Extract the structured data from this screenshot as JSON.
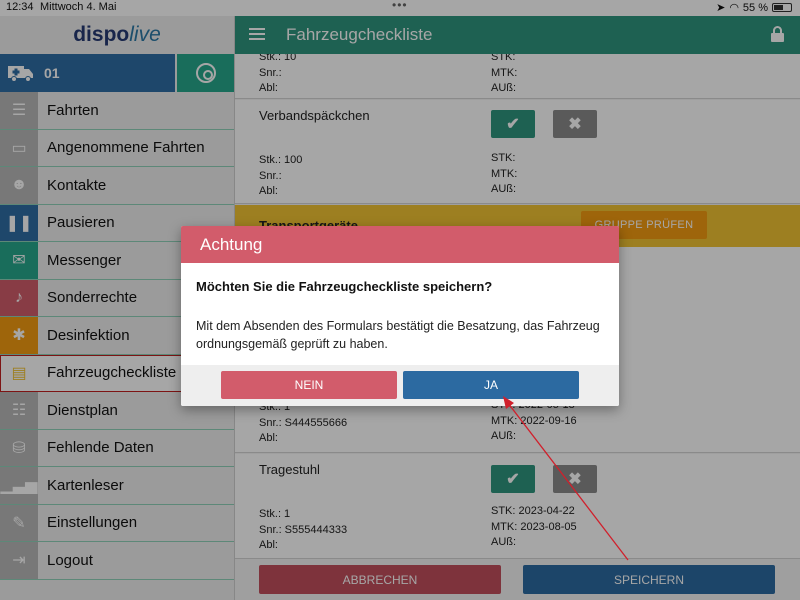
{
  "status_bar": {
    "time": "12:34",
    "date": "Mittwoch 4. Mai",
    "battery": "55 %"
  },
  "sidebar": {
    "logo_part1": "dispo",
    "logo_part2": "live",
    "vehicle_number": "01",
    "items": [
      {
        "label": "Fahrten",
        "icon": "list-icon",
        "color": "#b8b8b8"
      },
      {
        "label": "Angenommene Fahrten",
        "icon": "id-card-icon",
        "color": "#b8b8b8"
      },
      {
        "label": "Kontakte",
        "icon": "users-icon",
        "color": "#b8b8b8"
      },
      {
        "label": "Pausieren",
        "icon": "pause-icon",
        "color": "#2f6da5"
      },
      {
        "label": "Messenger",
        "icon": "envelope-icon",
        "color": "#27a88d"
      },
      {
        "label": "Sonderrechte",
        "icon": "bell-icon",
        "color": "#d25c6b"
      },
      {
        "label": "Desinfektion",
        "icon": "bug-icon",
        "color": "#f39c12"
      },
      {
        "label": "Fahrzeugcheckliste",
        "icon": "book-icon",
        "color": "#f2c333"
      },
      {
        "label": "Dienstplan",
        "icon": "list-alt-icon",
        "color": "#b8b8b8"
      },
      {
        "label": "Fehlende Daten",
        "icon": "database-icon",
        "color": "#b8b8b8"
      },
      {
        "label": "Kartenleser",
        "icon": "signal-icon",
        "color": "#b8b8b8"
      },
      {
        "label": "Einstellungen",
        "icon": "wrench-icon",
        "color": "#b8b8b8"
      },
      {
        "label": "Logout",
        "icon": "logout-icon",
        "color": "#b8b8b8"
      }
    ]
  },
  "header": {
    "title": "Fahrzeugcheckliste"
  },
  "content": {
    "top_item": {
      "stk": "Stk.: 10",
      "snr": "Snr.:",
      "abl": "Abl:",
      "stk_date": "STK:",
      "mtk_date": "MTK:",
      "aus": "AUß:"
    },
    "item_verband": {
      "name": "Verbandspäckchen",
      "stk": "Stk.: 100",
      "snr": "Snr.:",
      "abl": "Abl:",
      "stk_date": "STK:",
      "mtk_date": "MTK:",
      "aus": "AUß:"
    },
    "group": {
      "title": "Transportgeräte",
      "button": "GRUPPE PRÜFEN"
    },
    "item_hidden": {
      "stk": "Stk.: 1",
      "snr": "Snr.: S444555666",
      "abl": "Abl:",
      "stk_date": "STK: 2022-05-18",
      "mtk_date": "MTK: 2022-09-16",
      "aus": "AUß:"
    },
    "item_tragestuhl": {
      "name": "Tragestuhl",
      "stk": "Stk.: 1",
      "snr": "Snr.: S555444333",
      "abl": "Abl:",
      "stk_date": "STK: 2023-04-22",
      "mtk_date": "MTK: 2023-08-05",
      "aus": "AUß:"
    }
  },
  "footer": {
    "cancel": "ABBRECHEN",
    "save": "SPEICHERN"
  },
  "dialog": {
    "title": "Achtung",
    "question": "Möchten Sie die Fahrzeugcheckliste speichern?",
    "text": "Mit dem Absenden des Formulars bestätigt die Besatzung, das Fahrzeug ordnungsgemäß geprüft zu haben.",
    "no": "NEIN",
    "yes": "JA"
  },
  "colors": {
    "header": "#2e957f",
    "vehicle": "#2f6da5",
    "dialog_header": "#d25c6b",
    "confirm": "#2c6aa1",
    "group_bar": "#f2c333",
    "annotation_arrow": "#d0202c"
  }
}
